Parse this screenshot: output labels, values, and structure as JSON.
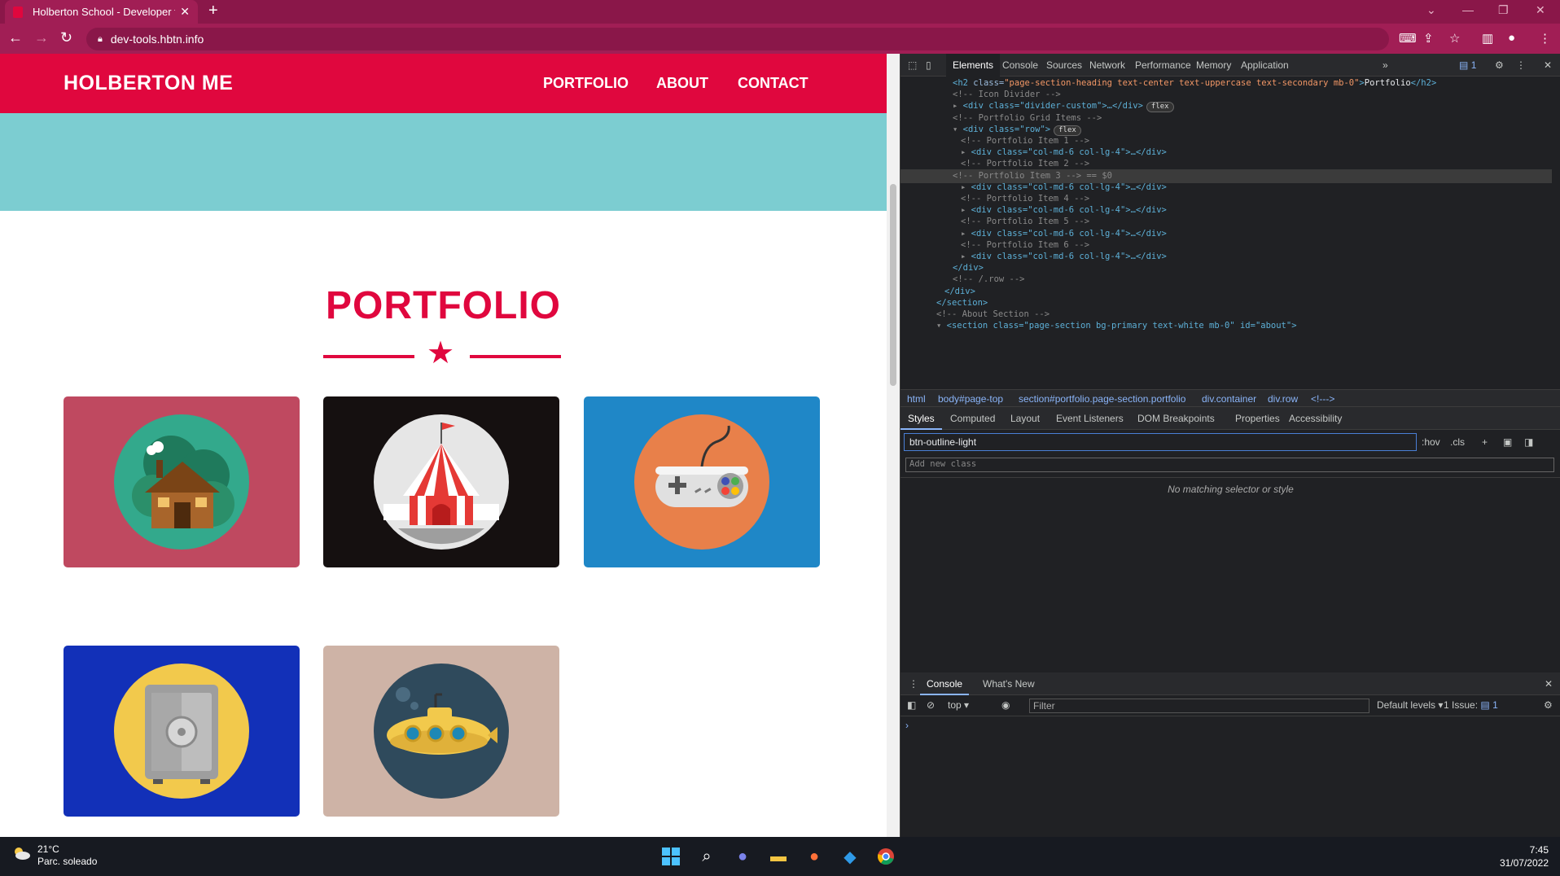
{
  "browser": {
    "tab_title": "Holberton School - Developer to",
    "close_glyph": "✕",
    "new_tab_glyph": "+",
    "url": "dev-tools.hbtn.info"
  },
  "site": {
    "brand": "HOLBERTON ME",
    "nav": [
      "PORTFOLIO",
      "ABOUT",
      "CONTACT"
    ],
    "section_title": "PORTFOLIO",
    "colors": {
      "primary": "#e0073e",
      "hero": "#7ccdd1"
    },
    "portfolio_items": [
      {
        "name": "cabin",
        "bg": "#bf4960"
      },
      {
        "name": "circus-tent",
        "bg": "#151010"
      },
      {
        "name": "game-controller",
        "bg": "#1f87c7"
      },
      {
        "name": "safe",
        "bg": "#1230b8"
      },
      {
        "name": "submarine",
        "bg": "#ceb3a6"
      }
    ]
  },
  "devtools": {
    "tabs": [
      "Elements",
      "Console",
      "Sources",
      "Network",
      "Performance",
      "Memory",
      "Application"
    ],
    "issues_badge": "1",
    "code_lines": [
      {
        "indent": 5,
        "html": "h2"
      },
      {
        "indent": 5,
        "text": "<!-- Icon Divider -->"
      },
      {
        "indent": 5,
        "text": "<div class=\"divider-custom\">…</div>",
        "badge": "flex"
      },
      {
        "indent": 5,
        "text": "<!-- Portfolio Grid Items -->"
      },
      {
        "indent": 5,
        "text": "<div class=\"row\">",
        "badge": "flex"
      },
      {
        "indent": 6,
        "text": "<!-- Portfolio Item 1 -->"
      },
      {
        "indent": 6,
        "text": "<div class=\"col-md-6 col-lg-4\">…</div>"
      },
      {
        "indent": 6,
        "text": "<!-- Portfolio Item 2 -->"
      },
      {
        "indent": 6,
        "text": "<!-- Portfolio Item 3 --> == $0"
      },
      {
        "indent": 6,
        "text": "<div class=\"col-md-6 col-lg-4\">…</div>"
      },
      {
        "indent": 6,
        "text": "<!-- Portfolio Item 4 -->"
      },
      {
        "indent": 6,
        "text": "<div class=\"col-md-6 col-lg-4\">…</div>"
      },
      {
        "indent": 6,
        "text": "<!-- Portfolio Item 5 -->"
      },
      {
        "indent": 6,
        "text": "<div class=\"col-md-6 col-lg-4\">…</div>"
      },
      {
        "indent": 6,
        "text": "<!-- Portfolio Item 6 -->"
      },
      {
        "indent": 6,
        "text": "<div class=\"col-md-6 col-lg-4\">…</div>"
      },
      {
        "indent": 5,
        "text": "</div>"
      },
      {
        "indent": 5,
        "text": "<!-- /.row -->"
      },
      {
        "indent": 4,
        "text": "</div>"
      },
      {
        "indent": 3,
        "text": "</section>"
      },
      {
        "indent": 3,
        "text": "<!-- About Section -->"
      },
      {
        "indent": 3,
        "text": "<section class=\"page-section bg-primary text-white mb-0\" id=\"about\">"
      }
    ],
    "h2_line": {
      "open": "<h2 ",
      "attr": "class=",
      "val": "\"page-section-heading text-center text-uppercase text-secondary mb-0\"",
      "close": ">",
      "text": "Portfolio",
      "end": "</h2>"
    },
    "breadcrumbs": [
      "html",
      "body#page-top",
      "section#portfolio.page-section.portfolio",
      "div.container",
      "div.row",
      "<!--->"
    ],
    "style_tabs": [
      "Styles",
      "Computed",
      "Layout",
      "Event Listeners",
      "DOM Breakpoints",
      "Properties",
      "Accessibility"
    ],
    "filter_value": "btn-outline-light",
    "hov": ":hov",
    "cls": ".cls",
    "add_class_placeholder": "Add new class",
    "no_match": "No matching selector or style",
    "console_tabs": [
      "Console",
      "What's New"
    ],
    "console_context": "top",
    "console_filter_placeholder": "Filter",
    "default_levels": "Default levels",
    "issues_text": "1 Issue:",
    "issues_count": "1",
    "prompt": "›"
  },
  "taskbar": {
    "temp": "21°C",
    "weather": "Parc. soleado",
    "time": "7:45",
    "date": "31/07/2022"
  }
}
